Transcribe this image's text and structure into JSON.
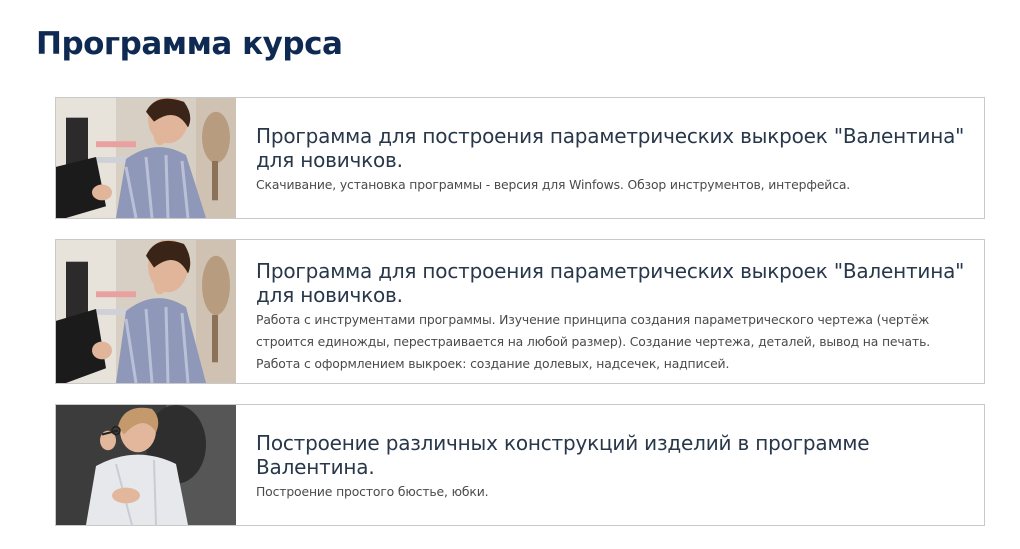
{
  "page": {
    "title": "Программа курса"
  },
  "courses": [
    {
      "title": "Программа для построения параметрических выкроек \"Валентина\" для новичков.",
      "description": "Скачивание, установка программы - версия для Winfows. Обзор инструментов, интерфейса."
    },
    {
      "title": "Программа для построения параметрических выкроек \"Валентина\" для новичков.",
      "description": "Работа с инструментами программы. Изучение принципа создания параметрического чертежа (чертёж строится единожды, перестраивается на любой размер). Создание чертежа, деталей, вывод на печать. Работа с оформлением выкроек: создание долевых, надсечек, надписей."
    },
    {
      "title": "Построение различных конструкций изделий в программе Валентина.",
      "description": "Построение простого бюстье, юбки."
    }
  ],
  "colors": {
    "title": "#0f2a52",
    "card_title": "#283749",
    "card_text": "#4a4a4a",
    "card_border": "#c9c9c9"
  }
}
